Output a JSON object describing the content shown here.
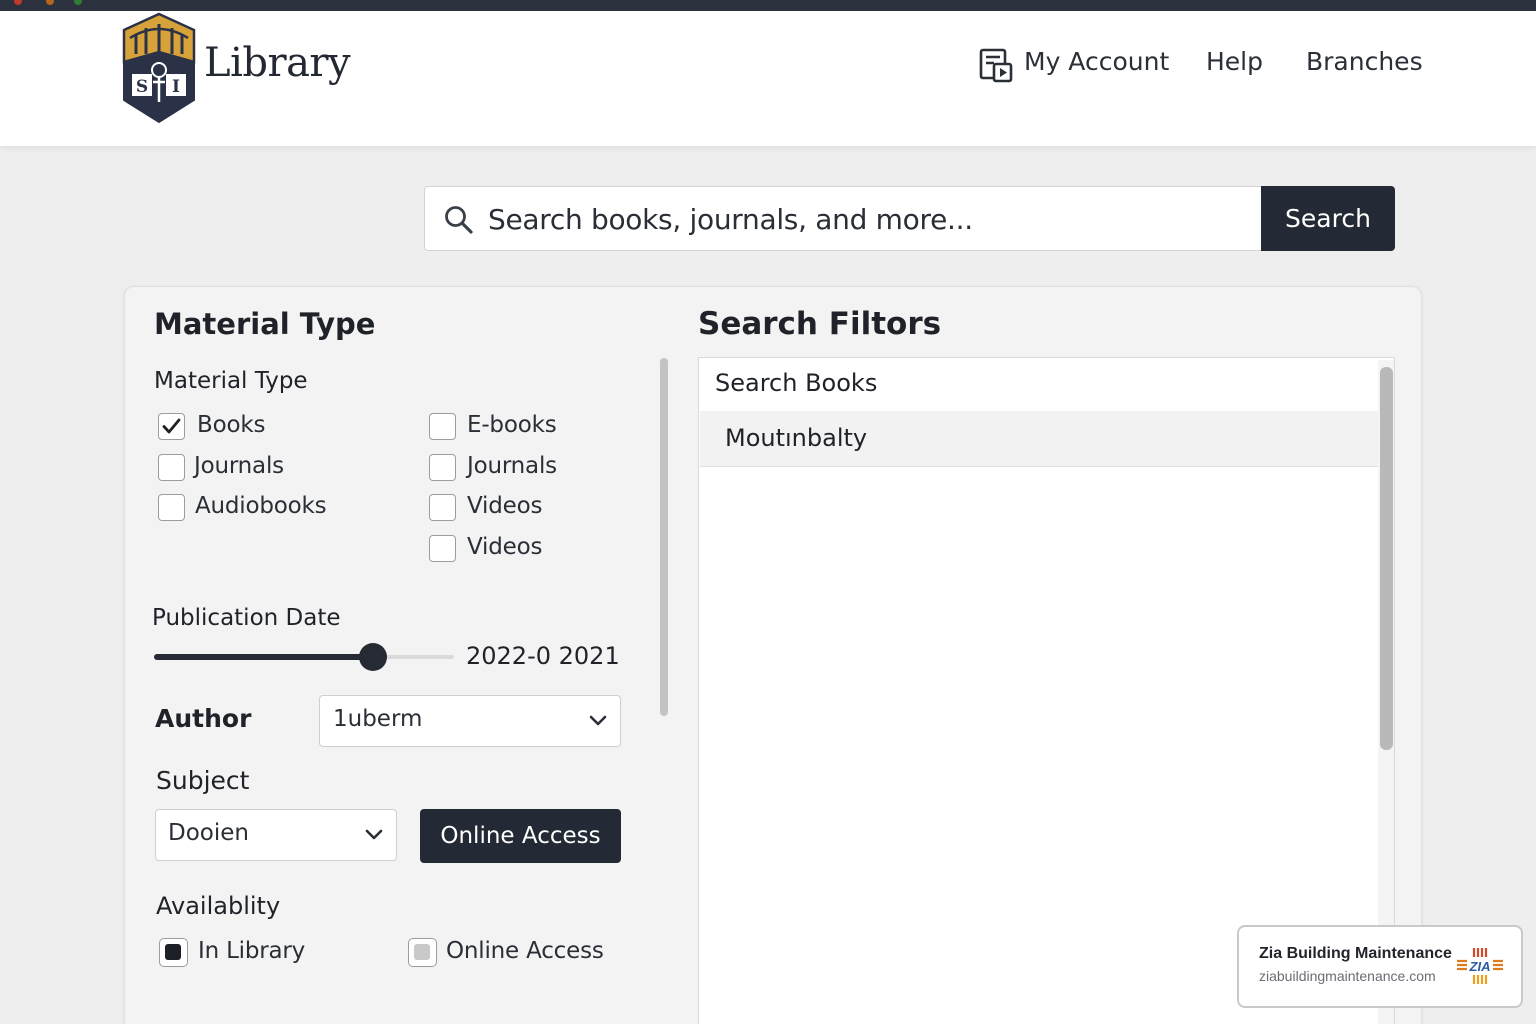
{
  "header": {
    "logo_text": "Library",
    "nav": {
      "my_account": "My Account",
      "help": "Help",
      "branches": "Branches"
    }
  },
  "search": {
    "placeholder": "Search books, journals, and more...",
    "button_label": "Search"
  },
  "filters": {
    "heading": "Material Type",
    "material_type": {
      "label": "Material Type",
      "options": [
        {
          "label": "Books",
          "checked": true
        },
        {
          "label": "E-books",
          "checked": false
        },
        {
          "label": "Journals",
          "checked": false
        },
        {
          "label": "Journals",
          "checked": false
        },
        {
          "label": "Audiobooks",
          "checked": false
        },
        {
          "label": "Videos",
          "checked": false
        },
        {
          "label": "Videos",
          "checked": false
        }
      ]
    },
    "publication_date": {
      "label": "Publication Date",
      "value_text": "2022-0 2021",
      "slider_fraction": 0.73
    },
    "author": {
      "label": "Author",
      "selected": "1uberm"
    },
    "subject": {
      "label": "Subject",
      "selected": "Dooien",
      "button_label": "Online Access"
    },
    "availability": {
      "label": "Availablity",
      "options": [
        {
          "label": "In Library",
          "selected": true
        },
        {
          "label": "Online Access",
          "selected": false
        }
      ]
    }
  },
  "results": {
    "heading": "Search Filtors",
    "items": [
      "Search Books",
      "Moutınbalty"
    ]
  },
  "watermark": {
    "title": "Zia Building Maintenance",
    "url": "ziabuildingmaintenance.com"
  },
  "colors": {
    "dark": "#242a35",
    "logo_gold": "#d8a23a",
    "logo_navy": "#2b3247",
    "background": "#eeeeee"
  }
}
